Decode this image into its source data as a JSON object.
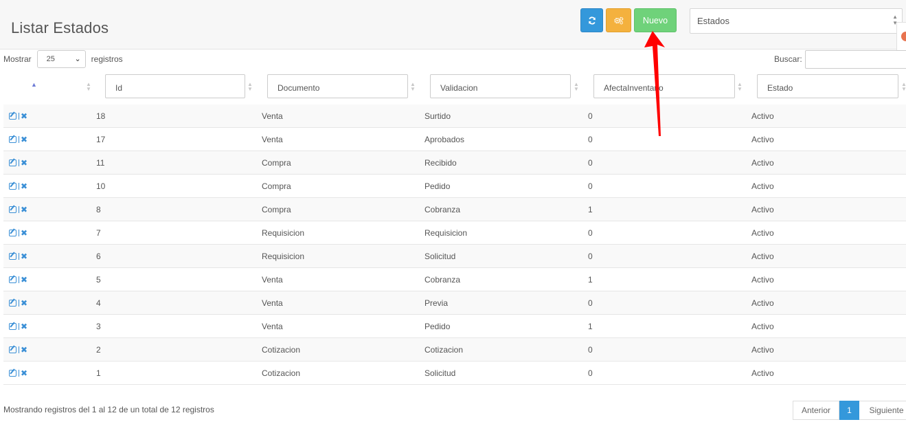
{
  "header": {
    "title": "Listar Estados",
    "new_label": "Nuevo",
    "module_value": "Estados"
  },
  "table_controls": {
    "show_label": "Mostrar",
    "page_length": "25",
    "records_label": "registros",
    "search_label": "Buscar:"
  },
  "filters": {
    "id": "Id",
    "documento": "Documento",
    "validacion": "Validacion",
    "afecta": "AfectaInventario",
    "estado": "Estado"
  },
  "rows": [
    {
      "id": "18",
      "documento": "Venta",
      "validacion": "Surtido",
      "afecta": "0",
      "estado": "Activo"
    },
    {
      "id": "17",
      "documento": "Venta",
      "validacion": "Aprobados",
      "afecta": "0",
      "estado": "Activo"
    },
    {
      "id": "11",
      "documento": "Compra",
      "validacion": "Recibido",
      "afecta": "0",
      "estado": "Activo"
    },
    {
      "id": "10",
      "documento": "Compra",
      "validacion": "Pedido",
      "afecta": "0",
      "estado": "Activo"
    },
    {
      "id": "8",
      "documento": "Compra",
      "validacion": "Cobranza",
      "afecta": "1",
      "estado": "Activo"
    },
    {
      "id": "7",
      "documento": "Requisicion",
      "validacion": "Requisicion",
      "afecta": "0",
      "estado": "Activo"
    },
    {
      "id": "6",
      "documento": "Requisicion",
      "validacion": "Solicitud",
      "afecta": "0",
      "estado": "Activo"
    },
    {
      "id": "5",
      "documento": "Venta",
      "validacion": "Cobranza",
      "afecta": "1",
      "estado": "Activo"
    },
    {
      "id": "4",
      "documento": "Venta",
      "validacion": "Previa",
      "afecta": "0",
      "estado": "Activo"
    },
    {
      "id": "3",
      "documento": "Venta",
      "validacion": "Pedido",
      "afecta": "1",
      "estado": "Activo"
    },
    {
      "id": "2",
      "documento": "Cotizacion",
      "validacion": "Cotizacion",
      "afecta": "0",
      "estado": "Activo"
    },
    {
      "id": "1",
      "documento": "Cotizacion",
      "validacion": "Solicitud",
      "afecta": "0",
      "estado": "Activo"
    }
  ],
  "footer": {
    "info": "Mostrando registros del 1 al 12 de un total de 12 registros",
    "prev": "Anterior",
    "current_page": "1",
    "next": "Siguiente"
  },
  "colors": {
    "refresh_button": "#3498db",
    "settings_button": "#f4b13e",
    "new_button": "#6fd27a",
    "annotation_arrow": "#ff0000",
    "action_icons": "#3a8fd6"
  },
  "icons": {
    "refresh": "refresh-icon",
    "settings": "gears-icon",
    "edit": "edit-icon",
    "delete": "delete-icon"
  }
}
